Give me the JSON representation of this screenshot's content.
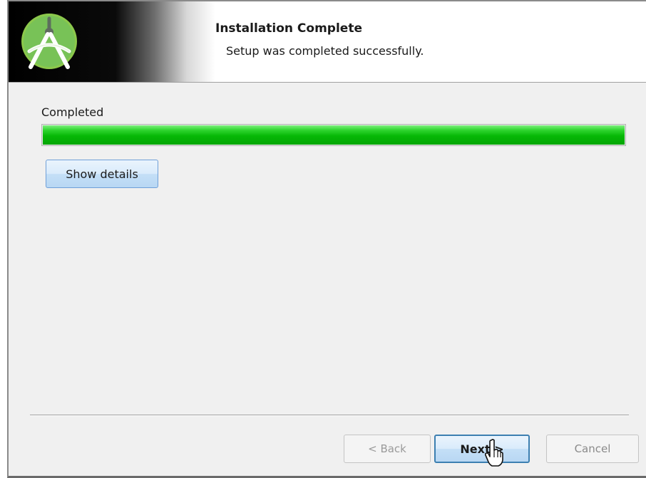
{
  "header": {
    "title": "Installation Complete",
    "subtitle": "Setup was completed successfully.",
    "logo_icon": "android-studio-icon"
  },
  "progress": {
    "label": "Completed",
    "percent": 100,
    "color": "#06b806"
  },
  "buttons": {
    "show_details": "Show details",
    "back": "< Back",
    "next": "Next >",
    "cancel": "Cancel"
  },
  "cursor_icon": "hand-pointer-icon"
}
